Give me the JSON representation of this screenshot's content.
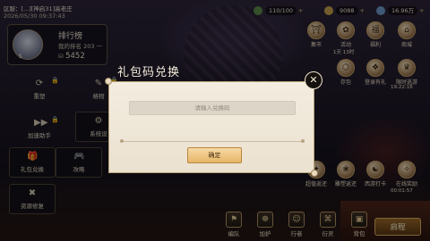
{
  "header": {
    "server_info": "区服：[...][神启31]高老庄",
    "datetime": "2026/05/30 09:37:43"
  },
  "rank_card": {
    "avatar_level": "5",
    "title": "排行榜",
    "my_rank": "我的排名 203 一",
    "score": "5452"
  },
  "left_menu": {
    "items": [
      {
        "label": "重塑",
        "icon": "circular-arrows-icon"
      },
      {
        "label": "格物",
        "icon": "brush-icon"
      },
      {
        "label": "加速助手",
        "icon": "fast-forward-icon"
      },
      {
        "label": "系统设",
        "icon": "gear-icon"
      },
      {
        "label": "礼包兑换",
        "icon": "gift-icon"
      },
      {
        "label": "攻略",
        "icon": "gamepad-icon"
      },
      {
        "label": "资源修复",
        "icon": "wrench-icon"
      }
    ]
  },
  "resources": {
    "stamina": "110/100",
    "coins": "9088",
    "gems": "16.96万"
  },
  "right_menu": {
    "items": [
      {
        "label": "集市"
      },
      {
        "label": "活动"
      },
      {
        "label": "福利"
      },
      {
        "label": "商城"
      },
      {
        "label": "存包"
      },
      {
        "label": "登录有礼"
      },
      {
        "label": "限时巡游"
      },
      {
        "label": "超值返还"
      },
      {
        "label": "雕塑返还"
      },
      {
        "label": "西游打卡"
      },
      {
        "label": "在线奖励"
      }
    ],
    "timer_top": "1天 13时",
    "timer_mid": "19:22:16",
    "timer_bottom": "00:01:57"
  },
  "bottom_nav": {
    "items": [
      "编队",
      "加护",
      "行者",
      "衍灵",
      "背包"
    ],
    "start_label": "启程"
  },
  "dialog": {
    "title": "礼包码兑换",
    "close_glyph": "✕",
    "input_placeholder": "请输入兑换码",
    "input_value": "",
    "confirm_label": "确定"
  },
  "colors": {
    "dialog_bg": "#f3ecdf",
    "confirm_bg": "#f6d9a4",
    "accent_gold": "#e8c57a"
  }
}
